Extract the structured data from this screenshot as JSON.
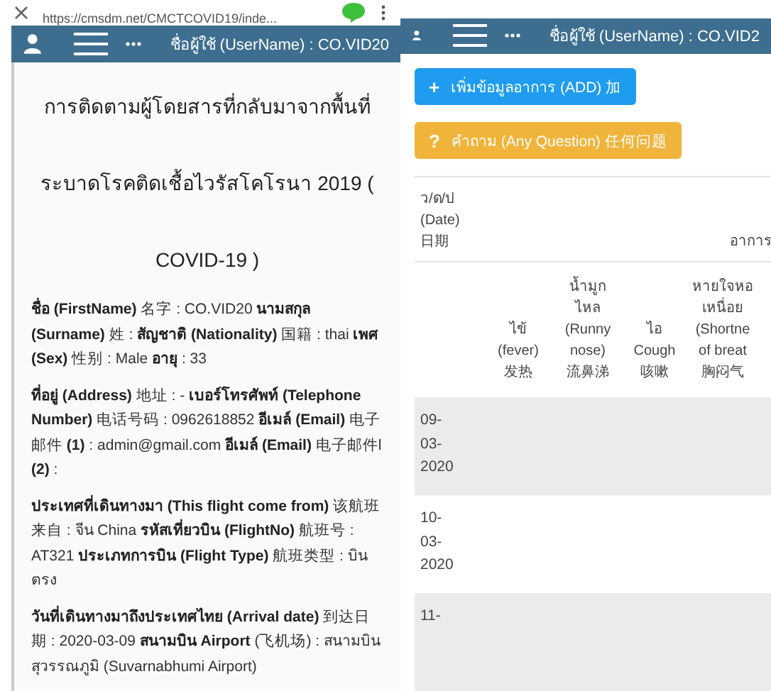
{
  "left": {
    "browser": {
      "url": "https://cmsdm.net/CMCTCOVID19/inde..."
    },
    "header": {
      "username": "ชื่อผู้ใช้ (UserName) : CO.VID20"
    },
    "title": [
      "การติดตามผู้โดยสารที่กลับมาจากพื้นที่",
      "ระบาดโรคติดเชื้อไวรัสโคโรนา 2019 (",
      "COVID-19 )"
    ],
    "paragraphs": [
      "**ชื่อ (FirstName)** 名字 : CO.VID20 **นามสกุล (Surname)** 姓 : **สัญชาติ (Nationality)** 国籍 : thai **เพศ (Sex)** 性别 : Male **อายุ** : 33",
      "**ที่อยู่ (Address)** 地址 : - **เบอร์โทรศัพท์ (Telephone Number)** 电话号码 : 0962618852 **อีเมล์ (Email)** 电子邮件 **(1)** : admin@gmail.com **อีเมล์ (Email)** 电子邮件l **(2)** :",
      "**ประเทศที่เดินทางมา (This flight come from)** 该航班来自 : จีน China **รหัสเที่ยวบิน (FlightNo)** 航班号 : AT321 **ประเภทการบิน (Flight Type)** 航班类型 : บินตรง",
      "**วันที่เดินทางมาถึงประเทศไทย (Arrival date)** 到达日期 : 2020-03-09 **สนามบิน Airport** (飞机场) : สนามบินสุวรรณภูมิ (Suvarnabhumi Airport)"
    ]
  },
  "right": {
    "header": {
      "username": "ชื่อผู้ใช้ (UserName) : CO.VID2"
    },
    "buttons": [
      {
        "kind": "add",
        "icon": "+",
        "label": "เพิ่มข้อมูลอาการ (ADD) 加"
      },
      {
        "kind": "question",
        "icon": "?",
        "label": "คำถาม (Any Question) 任何问题"
      }
    ],
    "table": {
      "date_header": [
        "ว/ด/ป",
        "(Date)",
        "日期"
      ],
      "group_header": "อาการ",
      "columns": [
        [
          "ไข้",
          "(fever)",
          "发热"
        ],
        [
          "น้ำมูก",
          "ไหล",
          "(Runny",
          "nose)",
          "流鼻涕"
        ],
        [
          "ไอ",
          "Cough",
          "咳嗽"
        ],
        [
          "หายใจหอ",
          "เหนื่อย",
          "(Shortne",
          "of breat",
          "胸闷气"
        ]
      ],
      "rows": [
        {
          "date": [
            "09-",
            "03-",
            "2020"
          ]
        },
        {
          "date": [
            "10-",
            "03-",
            "2020"
          ]
        },
        {
          "date": [
            "11-"
          ]
        }
      ]
    }
  }
}
